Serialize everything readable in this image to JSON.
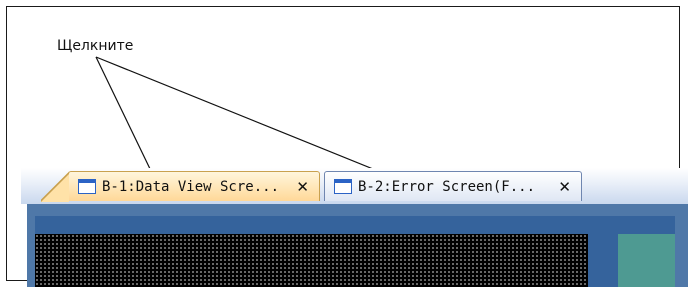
{
  "callout": {
    "label": "Щелкните"
  },
  "tabs": [
    {
      "label": "B-1:Data View Scre...",
      "close": "✕",
      "active": true
    },
    {
      "label": "B-2:Error Screen(F...",
      "close": "✕",
      "active": false
    }
  ],
  "colors": {
    "active_tab": "#ffd898",
    "inactive_tab": "#dfe7f4",
    "workspace": "#4f78a8",
    "teal": "#4e9a92",
    "icon_blue": "#2b63c5"
  },
  "icons": {
    "tab_icon": "window-icon",
    "close_icon": "close-icon"
  }
}
